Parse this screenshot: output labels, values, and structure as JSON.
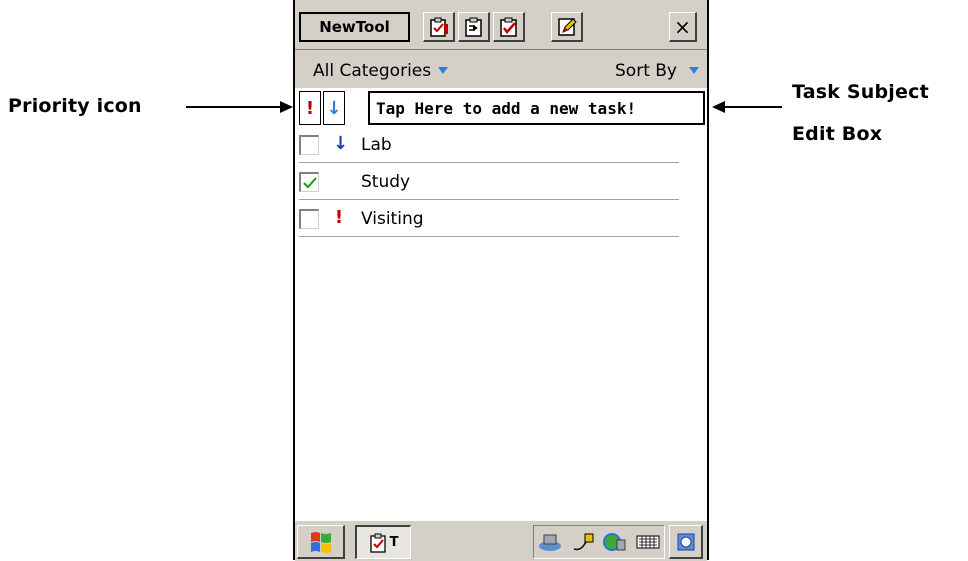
{
  "callouts": {
    "priority_icon": "Priority icon",
    "task_subject_line1": "Task Subject",
    "task_subject_line2": "Edit Box"
  },
  "toolbar": {
    "new_label": "New",
    "tool_label": "Tool",
    "icons": [
      "task-properties-icon",
      "task-move-icon",
      "task-complete-icon",
      "edit-icon"
    ],
    "close_label": "×"
  },
  "category_bar": {
    "category_label": "All Categories",
    "sort_label": "Sort By"
  },
  "new_task": {
    "high_priority_glyph": "!",
    "low_priority_glyph": "↓",
    "subject_placeholder": "Tap Here to add a new task!"
  },
  "tasks": [
    {
      "subject": "Lab",
      "completed": false,
      "priority": "low",
      "priority_glyph": "↓"
    },
    {
      "subject": "Study",
      "completed": true,
      "priority": "normal",
      "priority_glyph": ""
    },
    {
      "subject": "Visiting",
      "completed": false,
      "priority": "high",
      "priority_glyph": "!"
    }
  ],
  "taskbar": {
    "app_label": "T",
    "tray_icons": [
      "network-icon",
      "power-plug-icon",
      "connection-icon",
      "keyboard-icon"
    ]
  },
  "colors": {
    "high_priority": "#c00000",
    "low_priority": "#1f3fa0",
    "accent_arrow": "#2f7fd8",
    "check": "#1a9a1a"
  }
}
